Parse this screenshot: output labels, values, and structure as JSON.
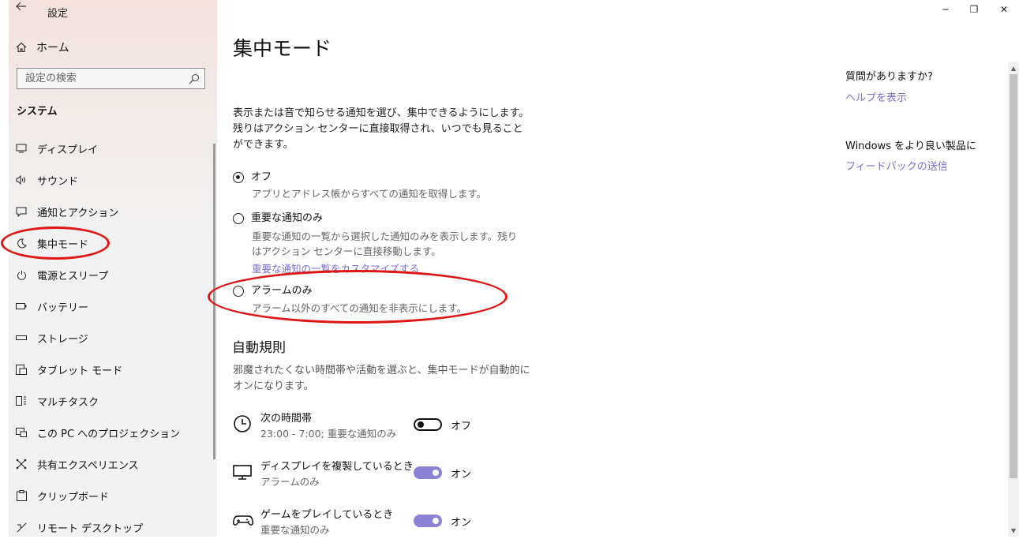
{
  "app": {
    "back_icon": "back-arrow-icon",
    "title": "設定"
  },
  "window_controls": {
    "minimize": "─",
    "maximize": "❐",
    "close": "✕"
  },
  "sidebar": {
    "home_label": "ホーム",
    "search_placeholder": "設定の検索",
    "section_title": "システム",
    "items": [
      {
        "label": "ディスプレイ",
        "icon": "display-icon"
      },
      {
        "label": "サウンド",
        "icon": "speaker-icon"
      },
      {
        "label": "通知とアクション",
        "icon": "notification-icon"
      },
      {
        "label": "集中モード",
        "icon": "moon-icon"
      },
      {
        "label": "電源とスリープ",
        "icon": "power-icon"
      },
      {
        "label": "バッテリー",
        "icon": "battery-icon"
      },
      {
        "label": "ストレージ",
        "icon": "storage-icon"
      },
      {
        "label": "タブレット モード",
        "icon": "tablet-icon"
      },
      {
        "label": "マルチタスク",
        "icon": "multitask-icon"
      },
      {
        "label": "この PC へのプロジェクション",
        "icon": "projection-icon"
      },
      {
        "label": "共有エクスペリエンス",
        "icon": "share-icon"
      },
      {
        "label": "クリップボード",
        "icon": "clipboard-icon"
      },
      {
        "label": "リモート デスクトップ",
        "icon": "remote-icon"
      }
    ]
  },
  "main": {
    "title": "集中モード",
    "description": "表示または音で知らせる通知を選び、集中できるようにします。残りはアクション センターに直接取得され、いつでも見ることができます。",
    "options": [
      {
        "label": "オフ",
        "sub": "アプリとアドレス帳からすべての通知を取得します。",
        "checked": true
      },
      {
        "label": "重要な通知のみ",
        "sub": "重要な通知の一覧から選択した通知のみを表示します。残りはアクション センターに直接移動します。",
        "link": "重要な通知の一覧をカスタマイズする",
        "checked": false
      },
      {
        "label": "アラームのみ",
        "sub": "アラーム以外のすべての通知を非表示にします。",
        "checked": false
      }
    ],
    "auto_rules_title": "自動規則",
    "auto_rules_desc": "邪魔されたくない時間帯や活動を選ぶと、集中モードが自動的にオンになります。",
    "rules": [
      {
        "title": "次の時間帯",
        "sub": "23:00 - 7:00; 重要な通知のみ",
        "state": "オフ",
        "on": false,
        "icon": "clock-icon"
      },
      {
        "title": "ディスプレイを複製しているとき",
        "sub": "アラームのみ",
        "state": "オン",
        "on": true,
        "icon": "monitor-icon"
      },
      {
        "title": "ゲームをプレイしているとき",
        "sub": "重要な通知のみ",
        "state": "オン",
        "on": true,
        "icon": "gamepad-icon"
      }
    ]
  },
  "right_panel": {
    "help_question": "質問がありますか?",
    "help_link": "ヘルプを表示",
    "feedback_question": "Windows をより良い製品に",
    "feedback_link": "フィードバックの送信"
  },
  "colors": {
    "accent": "#8b82d6",
    "link": "#7a6fd0",
    "annotation": "#e01515"
  }
}
